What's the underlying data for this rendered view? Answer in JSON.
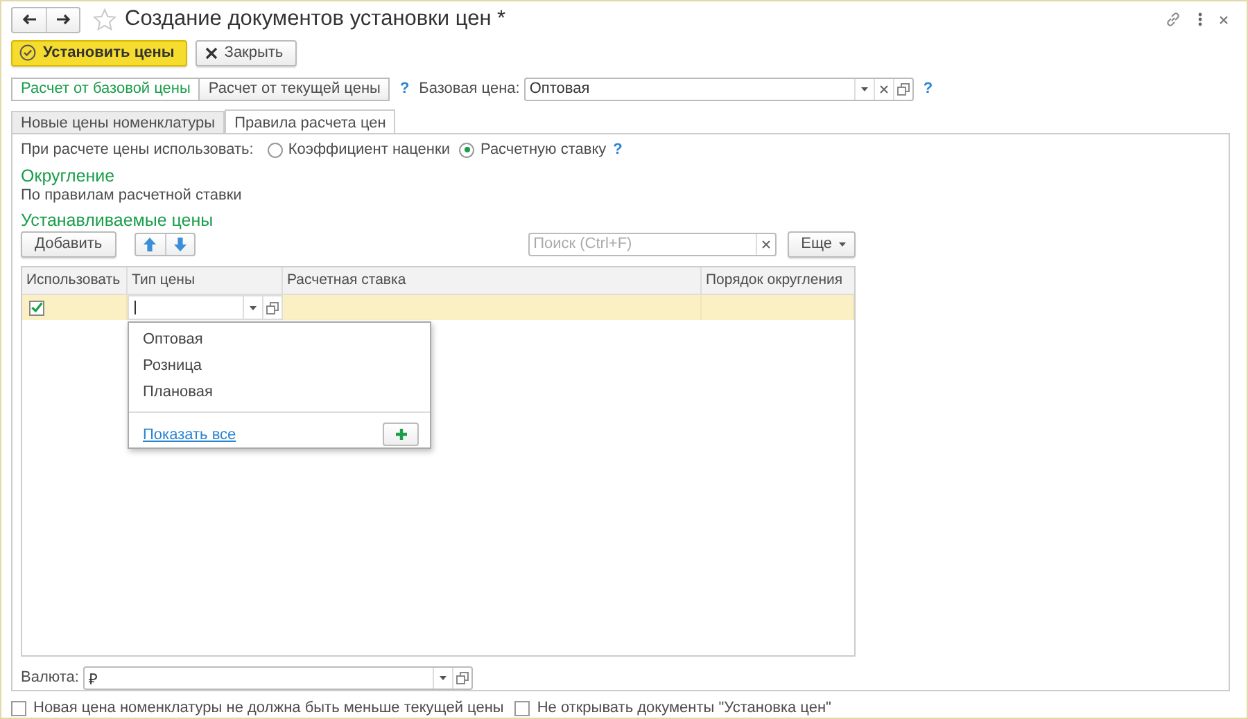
{
  "window": {
    "title": "Создание документов установки цен *"
  },
  "command_bar": {
    "buttons": [
      {
        "label": "Установить цены",
        "kind": "primary"
      },
      {
        "label": "Закрыть",
        "kind": "close"
      }
    ]
  },
  "calc_mode": {
    "options": [
      {
        "label": "Расчет от базовой цены",
        "selected": true
      },
      {
        "label": "Расчет от текущей цены",
        "selected": false
      }
    ],
    "help": "?"
  },
  "base_price": {
    "label": "Базовая цена:",
    "value": "Оптовая",
    "help": "?"
  },
  "tabs": [
    {
      "label": "Новые цены номенклатуры",
      "selected": false
    },
    {
      "label": "Правила расчета цен",
      "selected": true
    }
  ],
  "price_source": {
    "label": "При расчете цены использовать:",
    "options": [
      {
        "label": "Коэффициент наценки",
        "selected": false
      },
      {
        "label": "Расчетную ставку",
        "selected": true
      }
    ],
    "help": "?"
  },
  "rounding": {
    "title": "Округление",
    "text": "По правилам расчетной ставки"
  },
  "prices": {
    "title": "Устанавливаемые цены",
    "add_button": "Добавить",
    "search": {
      "placeholder": "Поиск (Ctrl+F)"
    },
    "more_button": "Еще",
    "table": {
      "columns": [
        "Использовать",
        "Тип цены",
        "Расчетная ставка",
        "Порядок округления"
      ],
      "rows": [
        {
          "use": true,
          "selected": true
        }
      ]
    }
  },
  "dropdown": {
    "items": [
      "Оптовая",
      "Розница",
      "Плановая"
    ],
    "show_all": "Показать все"
  },
  "currency": {
    "label": "Валюта:",
    "value": "₽"
  },
  "options": [
    {
      "label": "Новая цена номенклатуры не должна быть меньше текущей цены",
      "checked": false
    },
    {
      "label": "Не открывать документы \"Установка цен\"",
      "checked": false
    }
  ]
}
